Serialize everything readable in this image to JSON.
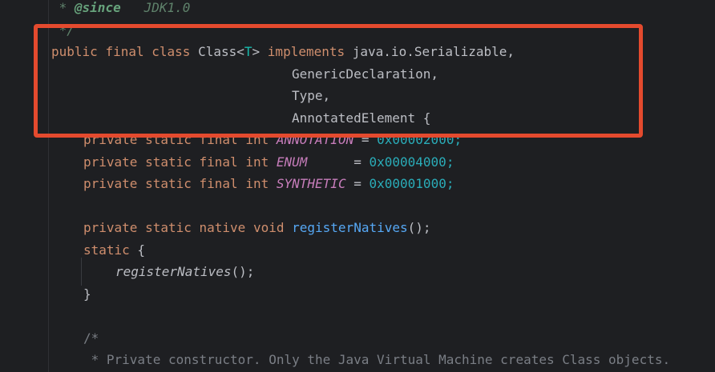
{
  "code": {
    "l1": {
      "star": " * ",
      "tag": "@since",
      "value": "   JDK1.0"
    },
    "l2": {
      "text": " */"
    },
    "l3": {
      "kw_public": "public",
      "kw_final": "final",
      "kw_class": "class",
      "name": "Class",
      "lt": "<",
      "type_param": "T",
      "gt": ">",
      "kw_implements": "implements",
      "iface": "java.io.Serializable,"
    },
    "l4": {
      "iface": "GenericDeclaration,"
    },
    "l5": {
      "iface": "Type,"
    },
    "l6": {
      "iface": "AnnotatedElement {"
    },
    "l7": {
      "kw_private": "private",
      "kw_static": "static",
      "kw_final": "final",
      "kw_int": "int",
      "field": "ANNOTATION",
      "eq": "=",
      "value": "0x00002000;"
    },
    "l8": {
      "kw_private": "private",
      "kw_static": "static",
      "kw_final": "final",
      "kw_int": "int",
      "field": "ENUM",
      "eq": "=",
      "value": "0x00004000;"
    },
    "l9": {
      "kw_private": "private",
      "kw_static": "static",
      "kw_final": "final",
      "kw_int": "int",
      "field": "SYNTHETIC",
      "eq": "=",
      "value": "0x00001000;"
    },
    "l10": {
      "kw_private": "private",
      "kw_static": "static",
      "kw_native": "native",
      "kw_void": "void",
      "method": "registerNatives",
      "tail": "();"
    },
    "l11": {
      "kw_static": "static",
      "tail": " {"
    },
    "l12": {
      "call": "registerNatives",
      "tail": "();"
    },
    "l13": {
      "text": "}"
    },
    "l14": {
      "text": "/*"
    },
    "l15": {
      "text": " * Private constructor. Only the Java Virtual Machine creates Class objects."
    }
  },
  "colors": {
    "keyword": "#cf8e6d",
    "highlight_border": "#e44a2e",
    "static_field": "#c77dbb",
    "number": "#2aacb8",
    "method": "#56a8f5"
  }
}
